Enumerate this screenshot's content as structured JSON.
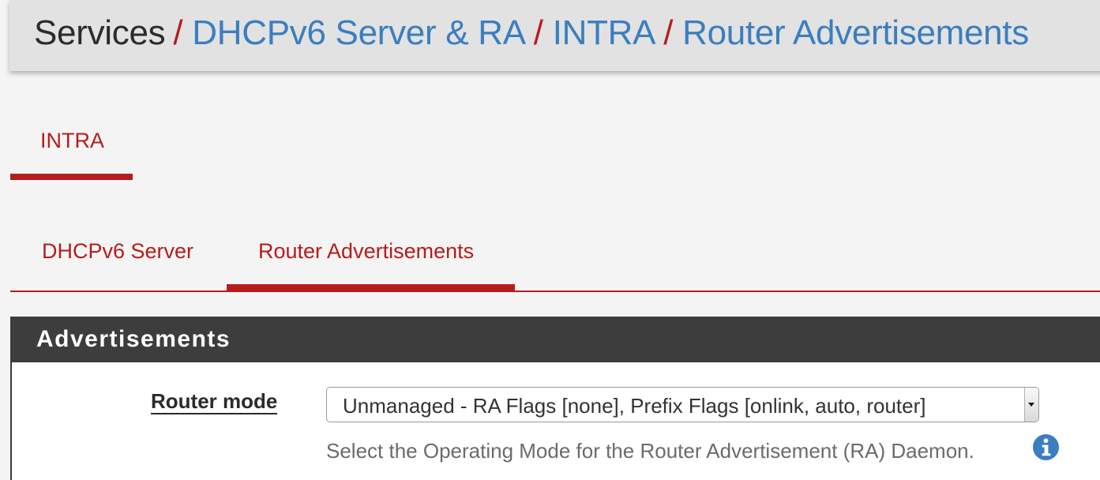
{
  "breadcrumb": {
    "root": "Services",
    "separator": "/",
    "items": [
      "DHCPv6 Server & RA",
      "INTRA",
      "Router Advertisements"
    ]
  },
  "interface_tabs": [
    {
      "label": "INTRA",
      "active": true
    }
  ],
  "sub_tabs": [
    {
      "label": "DHCPv6 Server",
      "active": false
    },
    {
      "label": "Router Advertisements",
      "active": true
    }
  ],
  "panel": {
    "title": "Advertisements",
    "fields": [
      {
        "label": "Router mode",
        "value": "Unmanaged - RA Flags [none], Prefix Flags [onlink, auto, router]",
        "help": "Select the Operating Mode for the Router Advertisement (RA) Daemon.",
        "help_icon": "info-circle-icon"
      }
    ]
  },
  "colors": {
    "accent": "#b71c1c",
    "link": "#3a7ec0",
    "panel_header": "#3d3d3d",
    "background": "#f4f4f4"
  }
}
